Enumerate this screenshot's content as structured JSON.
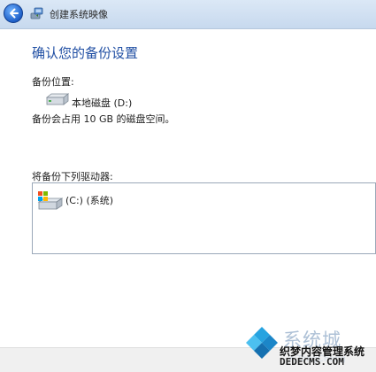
{
  "window": {
    "title": "创建系统映像"
  },
  "main": {
    "heading": "确认您的备份设置",
    "backup_location_label": "备份位置:",
    "drive_name": "本地磁盘 (D:)",
    "space_note": "备份会占用 10 GB 的磁盘空间。",
    "drives_label": "将备份下列驱动器:",
    "drives": [
      {
        "label": "(C:) (系统)"
      }
    ]
  },
  "watermark": {
    "brand_text": "系统城",
    "site_name_cn": "织梦内容管理系统",
    "url": "DEDECMS.COM",
    "faint_text": "XiTongCheng"
  },
  "colors": {
    "accent": "#1f4ea3",
    "titlebar": "#c7d9ee"
  },
  "icons": [
    "back-arrow-icon",
    "system-image-icon",
    "hard-drive-icon",
    "windows-drive-icon",
    "watermark-logo-icon"
  ]
}
